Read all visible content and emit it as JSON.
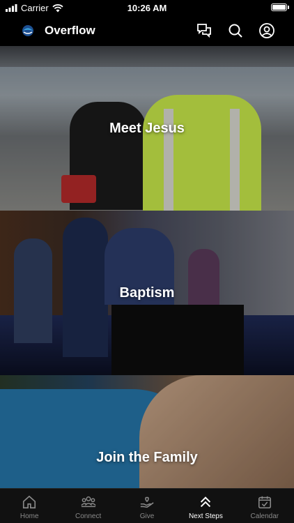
{
  "status_bar": {
    "carrier": "Carrier",
    "time": "10:26 AM"
  },
  "header": {
    "title": "Overflow",
    "icons": [
      "chat-icon",
      "search-icon",
      "profile-icon"
    ]
  },
  "cards": [
    {
      "label": "Meet Jesus"
    },
    {
      "label": "Baptism"
    },
    {
      "label": "Join the Family"
    }
  ],
  "tabs": [
    {
      "label": "Home",
      "icon": "home-icon"
    },
    {
      "label": "Connect",
      "icon": "connect-icon"
    },
    {
      "label": "Give",
      "icon": "give-icon"
    },
    {
      "label": "Next Steps",
      "icon": "chevrons-up-icon",
      "active": true
    },
    {
      "label": "Calendar",
      "icon": "calendar-icon"
    }
  ],
  "colors": {
    "background": "#000000",
    "tab_active": "#ffffff",
    "tab_inactive": "#8a8a8a"
  }
}
